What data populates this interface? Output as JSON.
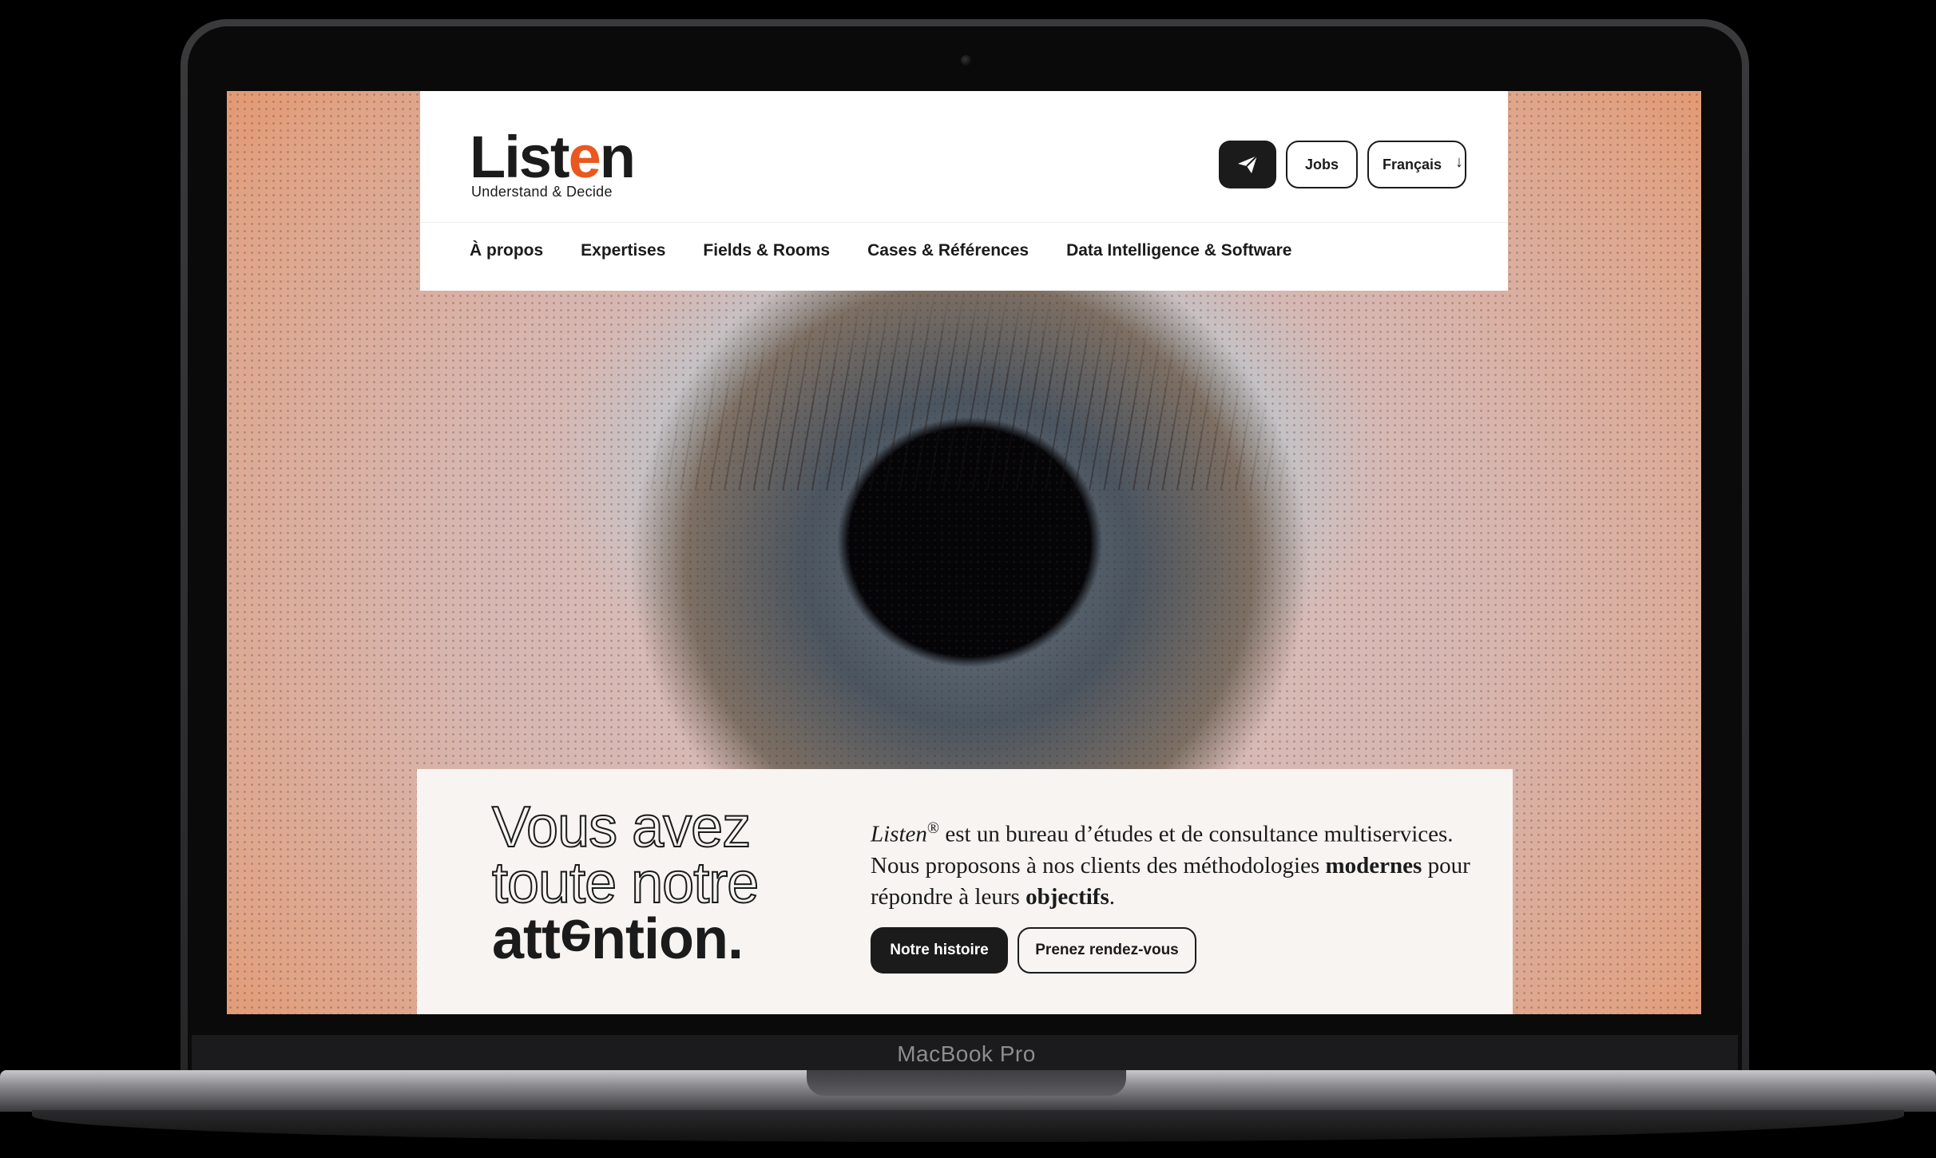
{
  "device": {
    "label": "MacBook Pro"
  },
  "header": {
    "logo": {
      "word_start": "List",
      "word_e": "e",
      "word_end": "n",
      "tagline": "Understand & Decide"
    },
    "actions": {
      "send_icon": "paper-plane-icon",
      "jobs_label": "Jobs",
      "language_label": "Français",
      "language_icon": "arrow-down-icon"
    },
    "nav": [
      {
        "label": "À propos"
      },
      {
        "label": "Expertises"
      },
      {
        "label": "Fields & Rooms"
      },
      {
        "label": "Cases & Références"
      },
      {
        "label": "Data Intelligence & Software"
      }
    ]
  },
  "hero": {
    "headline_line1": "Vous avez",
    "headline_line2": "toute notre",
    "headline_line3_start": "att",
    "headline_line3_e": "e",
    "headline_line3_end": "ntion.",
    "intro": {
      "brand": "Listen",
      "registered": "®",
      "text1": " est un bureau d’études et de consultance multiservices. Nous proposons à nos clients des méthodologies ",
      "bold1": "modernes",
      "text2": " pour répondre à leurs ",
      "bold2": "objectifs",
      "text3": "."
    },
    "primary_button": "Notre histoire",
    "secondary_button": "Prenez rendez-vous"
  }
}
